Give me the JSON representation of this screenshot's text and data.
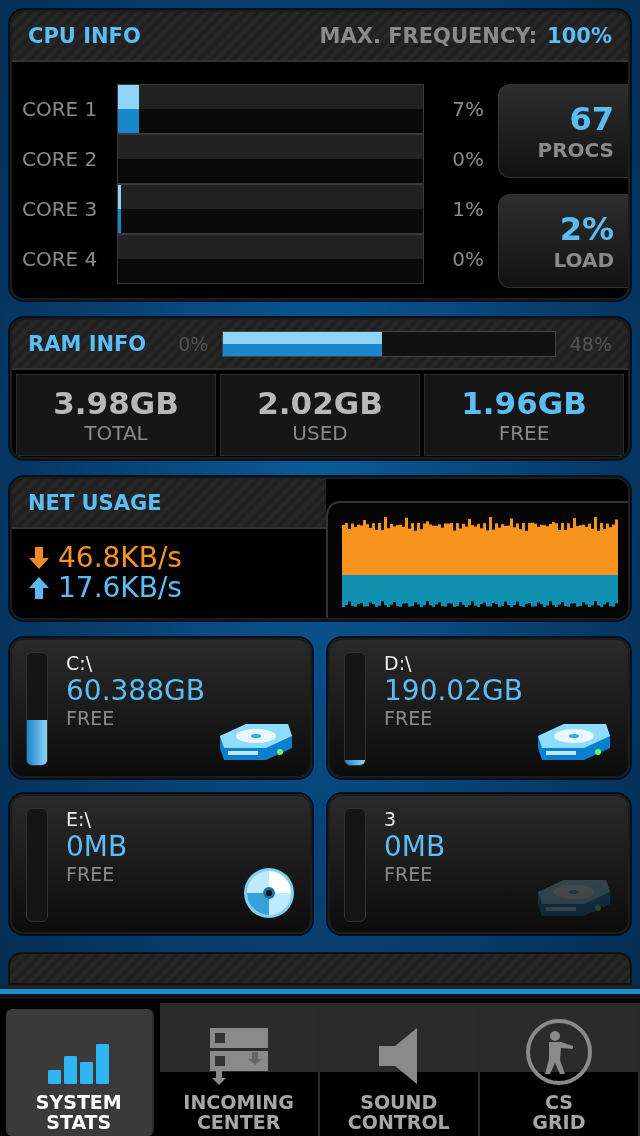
{
  "cpu": {
    "title": "CPU INFO",
    "frequency_label": "MAX. FREQUENCY:",
    "frequency_value": "100%",
    "cores": [
      {
        "label": "CORE 1",
        "level": 0.07,
        "reading": "7%"
      },
      {
        "label": "CORE 2",
        "level": 0,
        "reading": "0%"
      },
      {
        "label": "CORE 3",
        "level": 0.01,
        "reading": "1%"
      },
      {
        "label": "CORE 4",
        "level": 0,
        "reading": "0%"
      }
    ],
    "stats": [
      {
        "value": "67",
        "label": "PROCS"
      },
      {
        "value": "2%",
        "label": "LOAD"
      }
    ]
  },
  "ram": {
    "title": "RAM INFO",
    "min_label": "0%",
    "level": 0.48,
    "reading": "48%",
    "stats": [
      {
        "value": "3.98GB",
        "label": "TOTAL",
        "highlight": false
      },
      {
        "value": "2.02GB",
        "label": "USED",
        "highlight": false
      },
      {
        "value": "1.96GB",
        "label": "FREE",
        "highlight": true
      }
    ]
  },
  "net": {
    "title": "NET USAGE",
    "download": "46.8KB/s",
    "upload": "17.6KB/s"
  },
  "drives": [
    {
      "name": "C:\\",
      "free": "60.388GB",
      "label": "FREE",
      "level": 0.4,
      "kind": "hdd",
      "dimmed": false
    },
    {
      "name": "D:\\",
      "free": "190.02GB",
      "label": "FREE",
      "level": 0.04,
      "kind": "hdd",
      "dimmed": false
    },
    {
      "name": "E:\\",
      "free": "0MB",
      "label": "FREE",
      "level": 0,
      "kind": "disc",
      "dimmed": false
    },
    {
      "name": "3",
      "free": "0MB",
      "label": "FREE",
      "level": 0,
      "kind": "hdd",
      "dimmed": true
    }
  ],
  "tabs": [
    {
      "label": "SYSTEM STATS",
      "selected": true
    },
    {
      "label": "INCOMING CENTER",
      "selected": false
    },
    {
      "label": "SOUND CONTROL",
      "selected": false
    },
    {
      "label": "CS GRID",
      "selected": false
    }
  ]
}
